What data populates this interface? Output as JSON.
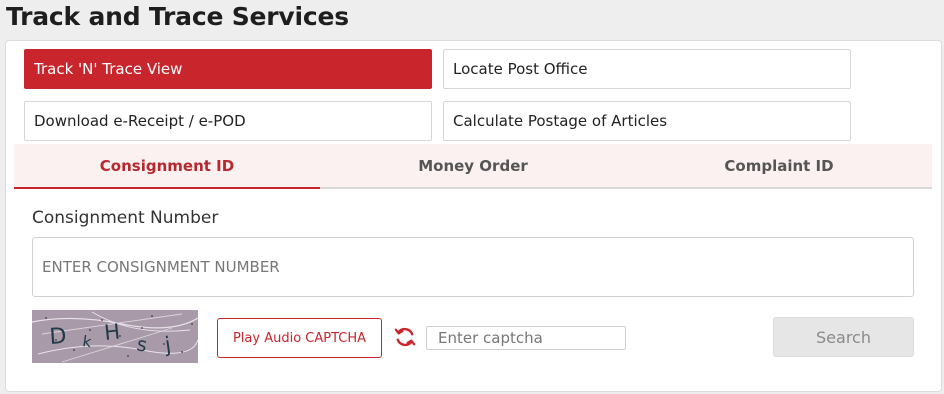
{
  "page": {
    "title": "Track and Trace Services"
  },
  "services": {
    "track_trace": "Track 'N' Trace View",
    "locate_po": "Locate Post Office",
    "download_receipt": "Download e-Receipt / e-POD",
    "calc_postage": "Calculate Postage of Articles"
  },
  "tabs": {
    "consignment": "Consignment ID",
    "money_order": "Money Order",
    "complaint": "Complaint ID",
    "active": "consignment"
  },
  "form": {
    "consignment_label": "Consignment Number",
    "consignment_placeholder": "ENTER CONSIGNMENT NUMBER",
    "consignment_value": "",
    "captcha_text": "D k H s j",
    "audio_label": "Play Audio CAPTCHA",
    "refresh_icon": "refresh-icon",
    "captcha_placeholder": "Enter captcha",
    "search_label": "Search"
  },
  "colors": {
    "accent": "#c8252c",
    "tab_background": "#fbf1f1",
    "disabled_button": "#e6e6e6"
  }
}
